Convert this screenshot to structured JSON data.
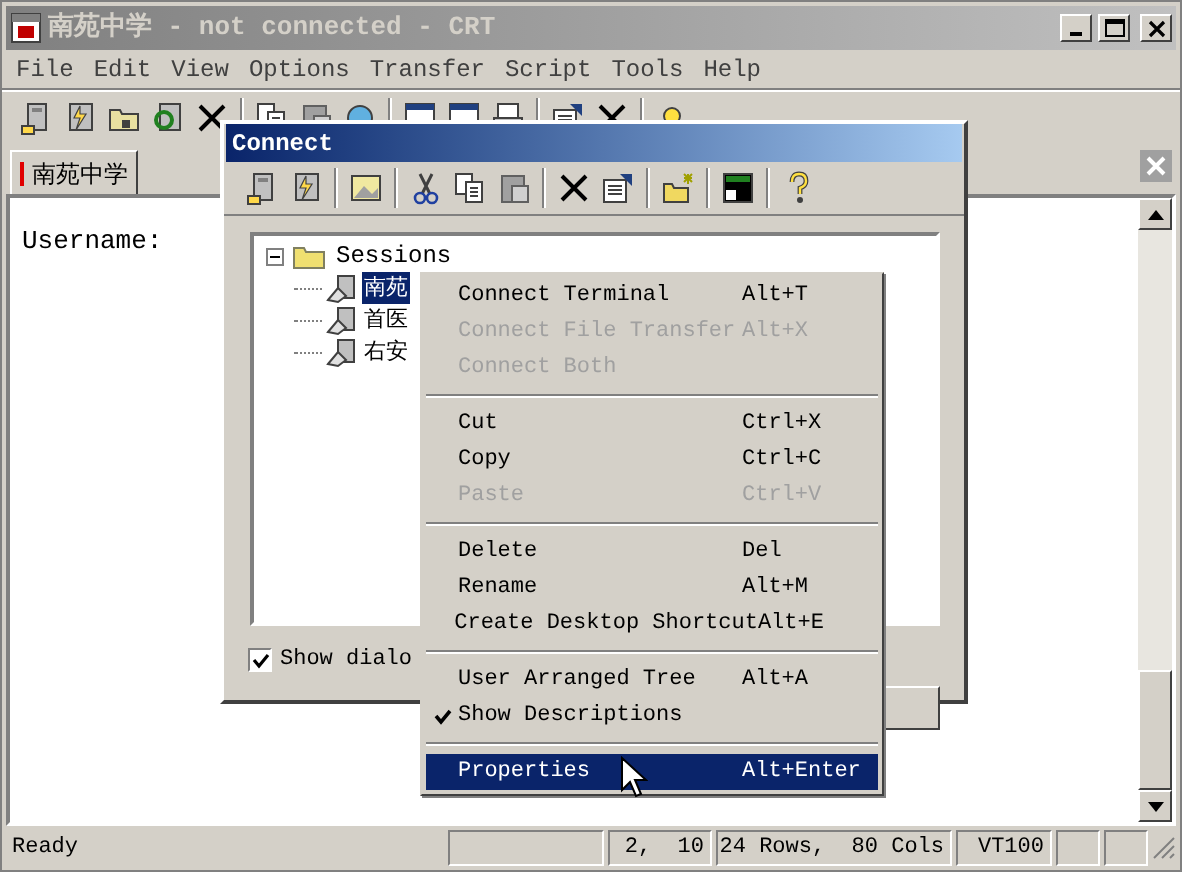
{
  "window": {
    "title": "南苑中学 - not connected - CRT",
    "active": false
  },
  "menu_bar": [
    "File",
    "Edit",
    "View",
    "Options",
    "Transfer",
    "Script",
    "Tools",
    "Help"
  ],
  "tabs": [
    {
      "label": "南苑中学",
      "selected": true
    }
  ],
  "terminal": {
    "lines": [
      "Username:"
    ]
  },
  "status_bar": [
    "Ready",
    "2,  10",
    "24 Rows,  80 Cols",
    "VT100"
  ],
  "dialog": {
    "title": "Connect",
    "tree": {
      "label": "Sessions",
      "expanded": true,
      "children": [
        {
          "label": "南苑",
          "selected": true
        },
        {
          "label": "首医",
          "selected": false
        },
        {
          "label": "右安",
          "selected": false
        }
      ]
    },
    "checkbox": {
      "label": "Show dialo",
      "checked": true
    }
  },
  "context_menu": [
    {
      "kind": "item",
      "label": "Connect Terminal",
      "shortcut": "Alt+T",
      "disabled": false,
      "checked": false,
      "selected": false
    },
    {
      "kind": "item",
      "label": "Connect File Transfer",
      "shortcut": "Alt+X",
      "disabled": true,
      "checked": false,
      "selected": false
    },
    {
      "kind": "item",
      "label": "Connect Both",
      "disabled": true,
      "checked": false,
      "selected": false
    },
    {
      "kind": "separator"
    },
    {
      "kind": "item",
      "label": "Cut",
      "shortcut": "Ctrl+X",
      "disabled": false,
      "checked": false,
      "selected": false
    },
    {
      "kind": "item",
      "label": "Copy",
      "shortcut": "Ctrl+C",
      "disabled": false,
      "checked": false,
      "selected": false
    },
    {
      "kind": "item",
      "label": "Paste",
      "shortcut": "Ctrl+V",
      "disabled": true,
      "checked": false,
      "selected": false
    },
    {
      "kind": "separator"
    },
    {
      "kind": "item",
      "label": "Delete",
      "shortcut": "Del",
      "disabled": false,
      "checked": false,
      "selected": false
    },
    {
      "kind": "item",
      "label": "Rename",
      "shortcut": "Alt+M",
      "disabled": false,
      "checked": false,
      "selected": false
    },
    {
      "kind": "item",
      "label": "Create Desktop Shortcut",
      "shortcut": "Alt+E",
      "disabled": false,
      "checked": false,
      "selected": false
    },
    {
      "kind": "separator"
    },
    {
      "kind": "item",
      "label": "User Arranged Tree",
      "shortcut": "Alt+A",
      "disabled": false,
      "checked": false,
      "selected": false
    },
    {
      "kind": "item",
      "label": "Show Descriptions",
      "disabled": false,
      "checked": true,
      "selected": false
    },
    {
      "kind": "separator"
    },
    {
      "kind": "item",
      "label": "Properties",
      "shortcut": "Alt+Enter",
      "disabled": false,
      "checked": false,
      "selected": true
    }
  ]
}
